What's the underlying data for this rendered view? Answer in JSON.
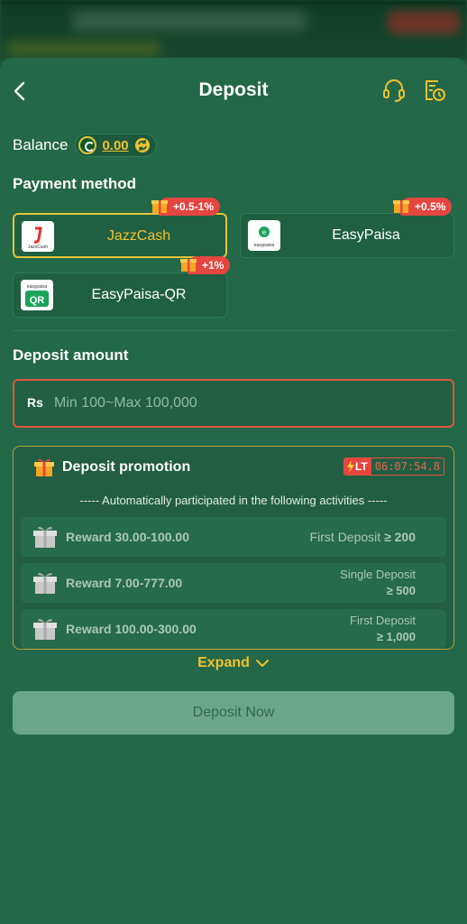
{
  "header": {
    "title": "Deposit"
  },
  "balance": {
    "label": "Balance",
    "amount": "0.00"
  },
  "payment": {
    "title": "Payment method",
    "methods": [
      {
        "name": "JazzCash",
        "bonus": "+0.5-1%",
        "selected": true
      },
      {
        "name": "EasyPaisa",
        "bonus": "+0.5%",
        "selected": false
      },
      {
        "name": "EasyPaisa-QR",
        "bonus": "+1%",
        "selected": false
      }
    ]
  },
  "amount": {
    "title": "Deposit amount",
    "currency": "Rs",
    "placeholder": "Min 100~Max 100,000",
    "value": ""
  },
  "promotion": {
    "title": "Deposit promotion",
    "timer_label": "LT",
    "timer": "06:07:54.8",
    "subtitle": "----- Automatically participated in the following activities -----",
    "rewards": [
      {
        "label": "Reward 30.00-100.00",
        "condition": "First Deposit",
        "value": "≥ 200"
      },
      {
        "label": "Reward 7.00-777.00",
        "condition": "Single Deposit",
        "value": "≥ 500"
      },
      {
        "label": "Reward 100.00-300.00",
        "condition": "First Deposit",
        "value": "≥ 1,000"
      }
    ]
  },
  "expand_label": "Expand",
  "deposit_button": "Deposit Now",
  "colors": {
    "accent": "#f2c12e",
    "bonus": "#e4463f",
    "sheet": "#236849"
  }
}
